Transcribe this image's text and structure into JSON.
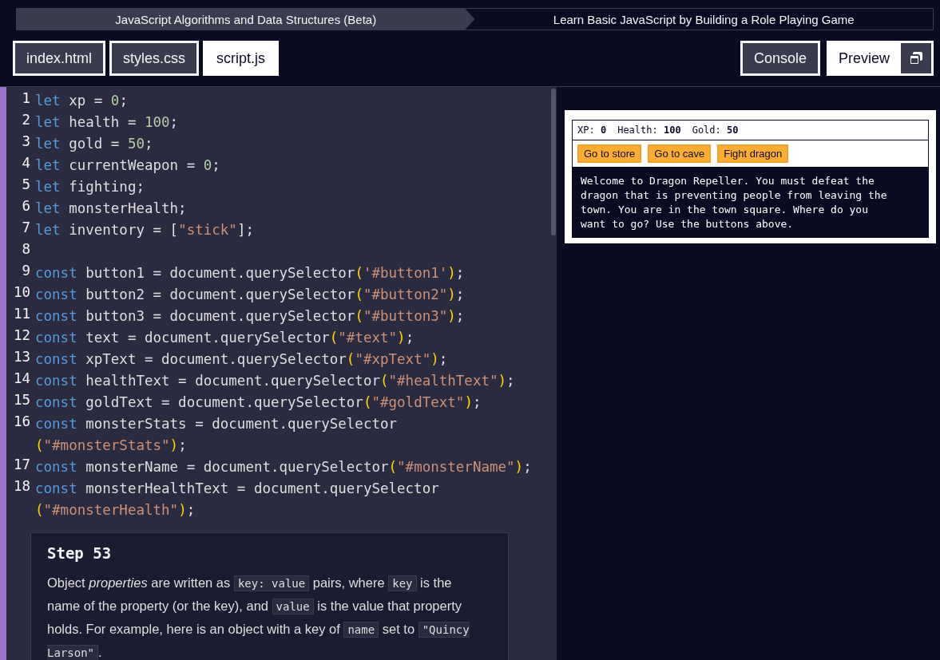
{
  "breadcrumb": [
    "JavaScript Algorithms and Data Structures (Beta)",
    "Learn Basic JavaScript by Building a Role Playing Game"
  ],
  "file_tabs": [
    {
      "label": "index.html",
      "selected": false
    },
    {
      "label": "styles.css",
      "selected": false
    },
    {
      "label": "script.js",
      "selected": true
    }
  ],
  "console_button": "Console",
  "preview_button": {
    "label": "Preview",
    "selected": true
  },
  "code_lines": [
    {
      "number": "1",
      "rows": [
        [
          {
            "kind": "keyword",
            "text": "let"
          },
          {
            "kind": "plain",
            "text": " xp = "
          },
          {
            "kind": "number",
            "text": "0"
          },
          {
            "kind": "plain",
            "text": ";"
          }
        ]
      ]
    },
    {
      "number": "2",
      "rows": [
        [
          {
            "kind": "keyword",
            "text": "let"
          },
          {
            "kind": "plain",
            "text": " health = "
          },
          {
            "kind": "number",
            "text": "100"
          },
          {
            "kind": "plain",
            "text": ";"
          }
        ]
      ]
    },
    {
      "number": "3",
      "rows": [
        [
          {
            "kind": "keyword",
            "text": "let"
          },
          {
            "kind": "plain",
            "text": " gold = "
          },
          {
            "kind": "number",
            "text": "50"
          },
          {
            "kind": "plain",
            "text": ";"
          }
        ]
      ]
    },
    {
      "number": "4",
      "rows": [
        [
          {
            "kind": "keyword",
            "text": "let"
          },
          {
            "kind": "plain",
            "text": " currentWeapon = "
          },
          {
            "kind": "number",
            "text": "0"
          },
          {
            "kind": "plain",
            "text": ";"
          }
        ]
      ]
    },
    {
      "number": "5",
      "rows": [
        [
          {
            "kind": "keyword",
            "text": "let"
          },
          {
            "kind": "plain",
            "text": " fighting;"
          }
        ]
      ]
    },
    {
      "number": "6",
      "rows": [
        [
          {
            "kind": "keyword",
            "text": "let"
          },
          {
            "kind": "plain",
            "text": " monsterHealth;"
          }
        ]
      ]
    },
    {
      "number": "7",
      "rows": [
        [
          {
            "kind": "keyword",
            "text": "let"
          },
          {
            "kind": "plain",
            "text": " inventory = ["
          },
          {
            "kind": "string",
            "text": "\"stick\""
          },
          {
            "kind": "plain",
            "text": "];"
          }
        ]
      ]
    },
    {
      "number": "8"
    },
    {
      "number": "9",
      "rows": [
        [
          {
            "kind": "keyword",
            "text": "const"
          },
          {
            "kind": "plain",
            "text": " button1 = document.querySelector"
          },
          {
            "kind": "bracket",
            "text": "("
          },
          {
            "kind": "string",
            "text": "'#button1'"
          },
          {
            "kind": "bracket",
            "text": ")"
          },
          {
            "kind": "plain",
            "text": ";"
          }
        ]
      ]
    },
    {
      "number": "10",
      "rows": [
        [
          {
            "kind": "keyword",
            "text": "const"
          },
          {
            "kind": "plain",
            "text": " button2 = document.querySelector"
          },
          {
            "kind": "bracket",
            "text": "("
          },
          {
            "kind": "string",
            "text": "\"#button2\""
          },
          {
            "kind": "bracket",
            "text": ")"
          },
          {
            "kind": "plain",
            "text": ";"
          }
        ]
      ]
    },
    {
      "number": "11",
      "rows": [
        [
          {
            "kind": "keyword",
            "text": "const"
          },
          {
            "kind": "plain",
            "text": " button3 = document.querySelector"
          },
          {
            "kind": "bracket",
            "text": "("
          },
          {
            "kind": "string",
            "text": "\"#button3\""
          },
          {
            "kind": "bracket",
            "text": ")"
          },
          {
            "kind": "plain",
            "text": ";"
          }
        ]
      ]
    },
    {
      "number": "12",
      "rows": [
        [
          {
            "kind": "keyword",
            "text": "const"
          },
          {
            "kind": "plain",
            "text": " text = document.querySelector"
          },
          {
            "kind": "bracket",
            "text": "("
          },
          {
            "kind": "string",
            "text": "\"#text\""
          },
          {
            "kind": "bracket",
            "text": ")"
          },
          {
            "kind": "plain",
            "text": ";"
          }
        ]
      ]
    },
    {
      "number": "13",
      "rows": [
        [
          {
            "kind": "keyword",
            "text": "const"
          },
          {
            "kind": "plain",
            "text": " xpText = document.querySelector"
          },
          {
            "kind": "bracket",
            "text": "("
          },
          {
            "kind": "string",
            "text": "\"#xpText\""
          },
          {
            "kind": "bracket",
            "text": ")"
          },
          {
            "kind": "plain",
            "text": ";"
          }
        ]
      ]
    },
    {
      "number": "14",
      "rows": [
        [
          {
            "kind": "keyword",
            "text": "const"
          },
          {
            "kind": "plain",
            "text": " healthText = document.querySelector"
          },
          {
            "kind": "bracket",
            "text": "("
          },
          {
            "kind": "string",
            "text": "\"#healthText\""
          },
          {
            "kind": "bracket",
            "text": ")"
          },
          {
            "kind": "plain",
            "text": ";"
          }
        ]
      ]
    },
    {
      "number": "15",
      "rows": [
        [
          {
            "kind": "keyword",
            "text": "const"
          },
          {
            "kind": "plain",
            "text": " goldText = document.querySelector"
          },
          {
            "kind": "bracket",
            "text": "("
          },
          {
            "kind": "string",
            "text": "\"#goldText\""
          },
          {
            "kind": "bracket",
            "text": ")"
          },
          {
            "kind": "plain",
            "text": ";"
          }
        ]
      ]
    },
    {
      "number": "16",
      "rows": [
        [
          {
            "kind": "keyword",
            "text": "const"
          },
          {
            "kind": "plain",
            "text": " monsterStats = document.querySelector"
          }
        ],
        [
          {
            "kind": "bracket",
            "text": "("
          },
          {
            "kind": "string",
            "text": "\"#monsterStats\""
          },
          {
            "kind": "bracket",
            "text": ")"
          },
          {
            "kind": "plain",
            "text": ";"
          }
        ]
      ]
    },
    {
      "number": "17",
      "rows": [
        [
          {
            "kind": "keyword",
            "text": "const"
          },
          {
            "kind": "plain",
            "text": " monsterName = document.querySelector"
          },
          {
            "kind": "bracket",
            "text": "("
          },
          {
            "kind": "string",
            "text": "\"#monsterName\""
          },
          {
            "kind": "bracket",
            "text": ")"
          },
          {
            "kind": "plain",
            "text": ";"
          }
        ]
      ]
    },
    {
      "number": "18",
      "rows": [
        [
          {
            "kind": "keyword",
            "text": "const"
          },
          {
            "kind": "plain",
            "text": " monsterHealthText = document.querySelector"
          }
        ],
        [
          {
            "kind": "bracket",
            "text": "("
          },
          {
            "kind": "string",
            "text": "\"#monsterHealth\""
          },
          {
            "kind": "bracket",
            "text": ")"
          },
          {
            "kind": "plain",
            "text": ";"
          }
        ]
      ]
    }
  ],
  "step": {
    "title": "Step 53",
    "paragraph": [
      {
        "kind": "text",
        "text": "Object *properties* are written as "
      },
      {
        "kind": "code",
        "text": "key: value"
      },
      {
        "kind": "text",
        "text": " pairs, where "
      },
      {
        "kind": "code",
        "text": "key"
      },
      {
        "kind": "text",
        "text": " is the name of the property (or the key), and "
      },
      {
        "kind": "code",
        "text": "value"
      },
      {
        "kind": "text",
        "text": " is the value that property holds. For example, here is an object with a key of "
      },
      {
        "kind": "code",
        "text": "name"
      },
      {
        "kind": "text",
        "text": " set to "
      },
      {
        "kind": "code",
        "text": "\"Quincy Larson\""
      },
      {
        "kind": "text",
        "text": "."
      }
    ]
  },
  "game": {
    "stats": [
      {
        "label": "XP:",
        "value": "0"
      },
      {
        "label": "Health:",
        "value": "100"
      },
      {
        "label": "Gold:",
        "value": "50"
      }
    ],
    "buttons": [
      "Go to store",
      "Go to cave",
      "Fight dragon"
    ],
    "text": "Welcome to Dragon Repeller. You must defeat the dragon that is preventing people from leaving the town. You are in the town square. Where do you want to go? Use the buttons above."
  }
}
